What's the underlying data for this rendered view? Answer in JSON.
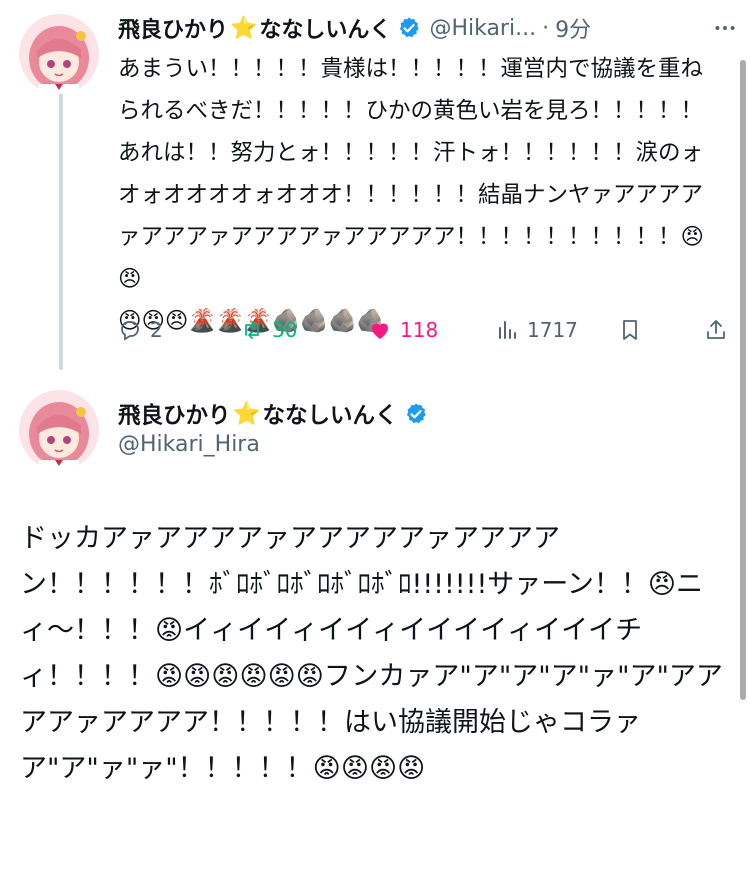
{
  "colors": {
    "accent": "#1d9bf0",
    "retweet": "#00ba7c",
    "like": "#f91880",
    "muted": "#536471"
  },
  "reply_tweet": {
    "display_name": "飛良ひかり",
    "name_star": "⭐",
    "name_suffix": "ななしいんく",
    "handle": "@Hikari...",
    "separator": "·",
    "time": "9分",
    "text": "あまうい！！！！！貴様は！！！！！運営内で協議を重ねられるべきだ！！！！！ひかの黄色い岩を見ろ！！！！！あれは！！努力とォ！！！！！汗トォ！！！！！！涙のォオォオオオオォオオオ！！！！！！結晶ナンヤァアアアアァアアアァアアアアァアアアアア！！！！！！！！！！😠😠\n😠😠😠🌋🌋🌋🪨🪨🪨🪨",
    "stats": {
      "replies": "2",
      "retweets": "30",
      "likes": "118",
      "views": "1717"
    }
  },
  "main_tweet": {
    "display_name": "飛良ひかり",
    "name_star": "⭐",
    "name_suffix": "ななしいんく",
    "handle": "@Hikari_Hira",
    "text": "ドッカアァアアアアァアアアアアァアアアアン！！！！！！ﾎﾞﾛﾎﾞﾛﾎﾞﾛﾎﾞﾛﾎﾞﾛ!!!!!!!サァーン！！😠ニィ〜！！！😡イィイイィイイィイイイイィイイイチィ！！！！😡😡😡😡😡😡フンカァア\"ア\"ア\"ア\"ァ\"ア\"アアアアァアアアア！！！！！はい協議開始じゃコラァア\"ア\"ァ\"ァ\"！！！！！😡😡😡😡"
  },
  "icons": {
    "verified": "verified-badge-icon",
    "more": "more-icon",
    "reply": "reply-icon",
    "retweet": "retweet-icon",
    "like": "heart-icon",
    "views": "views-icon",
    "bookmark": "bookmark-icon",
    "share": "share-icon"
  }
}
